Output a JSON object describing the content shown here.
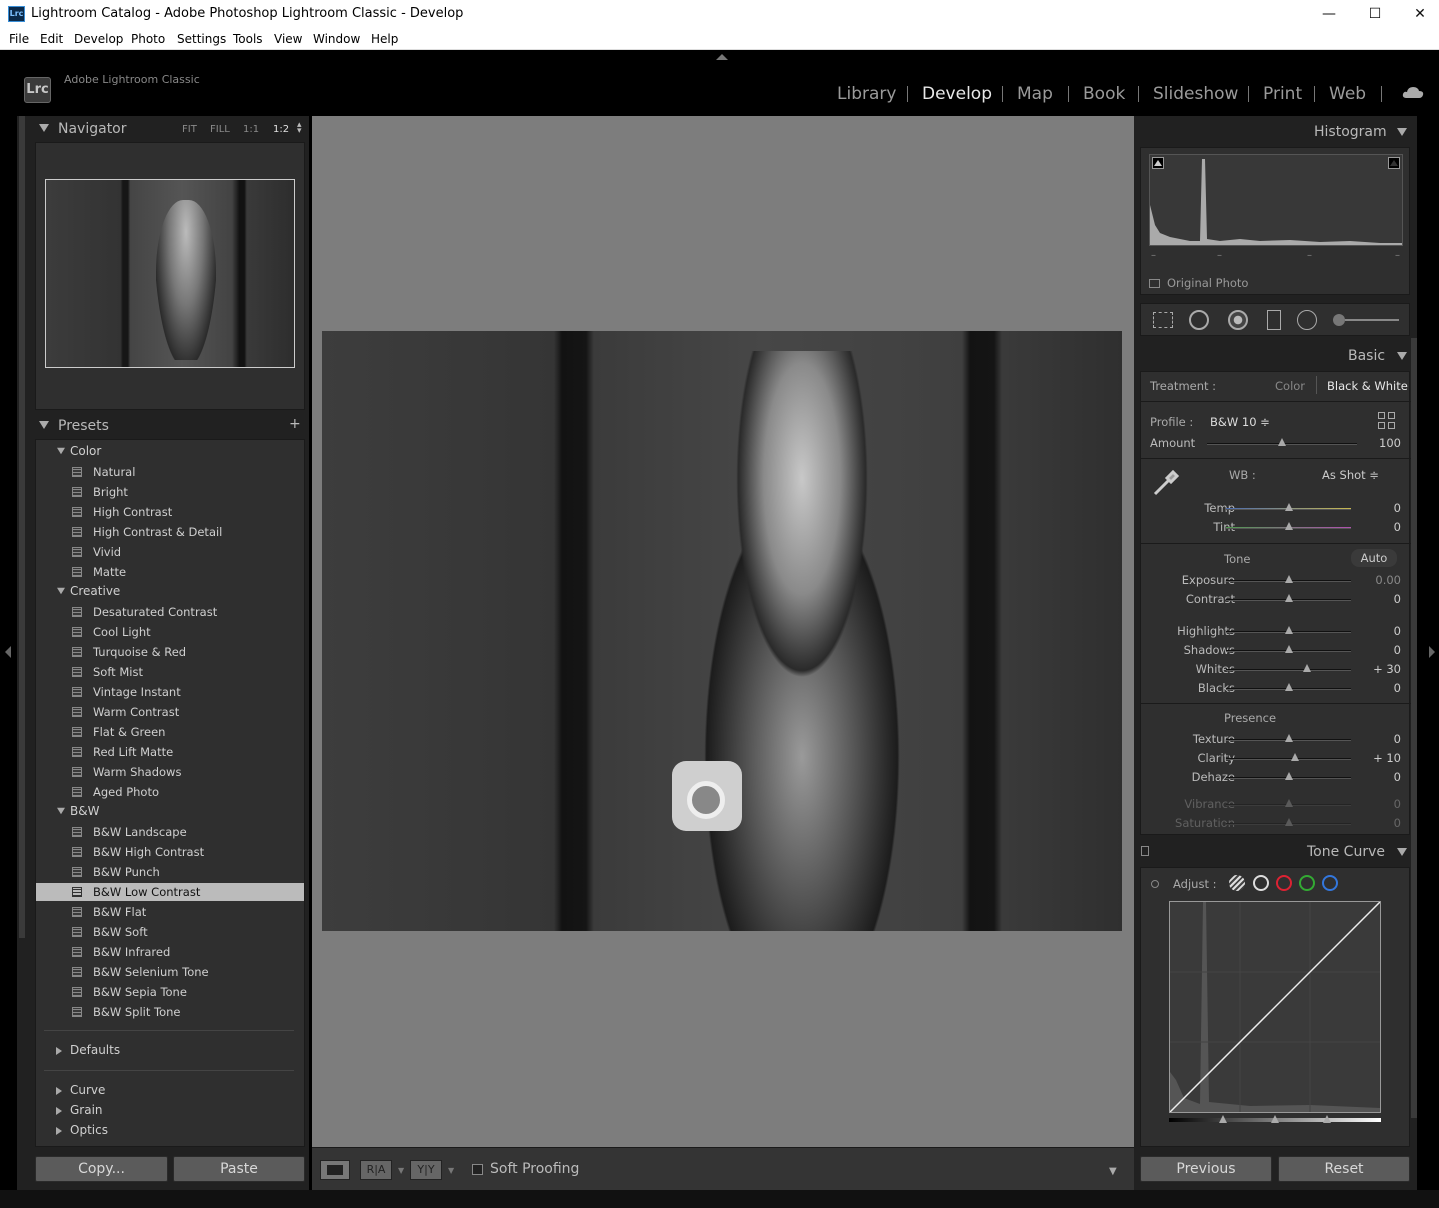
{
  "window": {
    "title": "Lightroom Catalog - Adobe Photoshop Lightroom Classic - Develop",
    "app_icon_text": "Lrc",
    "minimize": "—",
    "maximize": "☐",
    "close": "✕"
  },
  "menu": [
    "File",
    "Edit",
    "Develop",
    "Photo",
    "Settings",
    "Tools",
    "View",
    "Window",
    "Help"
  ],
  "identity": {
    "logo": "Lrc",
    "brand": "Adobe Lightroom Classic"
  },
  "modules": [
    {
      "label": "Library",
      "active": false
    },
    {
      "label": "Develop",
      "active": true
    },
    {
      "label": "Map",
      "active": false
    },
    {
      "label": "Book",
      "active": false
    },
    {
      "label": "Slideshow",
      "active": false
    },
    {
      "label": "Print",
      "active": false
    },
    {
      "label": "Web",
      "active": false
    }
  ],
  "navigator": {
    "title": "Navigator",
    "zoom_options": [
      "FIT",
      "FILL",
      "1:1",
      "1:2"
    ],
    "selected_zoom": "1:2"
  },
  "presets": {
    "title": "Presets",
    "add_label": "+",
    "groups": [
      {
        "name": "Color",
        "items": [
          "Natural",
          "Bright",
          "High Contrast",
          "High Contrast & Detail",
          "Vivid",
          "Matte"
        ]
      },
      {
        "name": "Creative",
        "items": [
          "Desaturated Contrast",
          "Cool Light",
          "Turquoise & Red",
          "Soft Mist",
          "Vintage Instant",
          "Warm Contrast",
          "Flat & Green",
          "Red Lift Matte",
          "Warm Shadows",
          "Aged Photo"
        ]
      },
      {
        "name": "B&W",
        "items": [
          "B&W Landscape",
          "B&W High Contrast",
          "B&W Punch",
          "B&W Low Contrast",
          "B&W Flat",
          "B&W Soft",
          "B&W Infrared",
          "B&W Selenium Tone",
          "B&W Sepia Tone",
          "B&W Split Tone"
        ]
      }
    ],
    "selected": "B&W Low Contrast",
    "collapsed_groups": [
      "Defaults",
      "Curve",
      "Grain",
      "Optics"
    ]
  },
  "left_buttons": {
    "copy": "Copy...",
    "paste": "Paste"
  },
  "toolbar": {
    "soft_proofing": "Soft Proofing",
    "view_ra": "R|A",
    "view_yy": "Y|Y"
  },
  "histogram": {
    "title": "Histogram",
    "original_photo": "Original Photo",
    "readouts": [
      "–",
      "–",
      "–",
      "–"
    ]
  },
  "basic": {
    "title": "Basic",
    "treatment_label": "Treatment :",
    "treatment_options": [
      "Color",
      "Black & White"
    ],
    "treatment_selected": "Black & White",
    "profile_label": "Profile :",
    "profile_value": "B&W 10 ≑",
    "amount_label": "Amount",
    "amount_value": "100",
    "wb_label": "WB :",
    "wb_value": "As Shot ≑",
    "temp": {
      "label": "Temp",
      "value": "0"
    },
    "tint": {
      "label": "Tint",
      "value": "0"
    },
    "tone_label": "Tone",
    "auto_label": "Auto",
    "exposure": {
      "label": "Exposure",
      "value": "0.00"
    },
    "contrast": {
      "label": "Contrast",
      "value": "0"
    },
    "highlights": {
      "label": "Highlights",
      "value": "0"
    },
    "shadows": {
      "label": "Shadows",
      "value": "0"
    },
    "whites": {
      "label": "Whites",
      "value": "+ 30"
    },
    "blacks": {
      "label": "Blacks",
      "value": "0"
    },
    "presence_label": "Presence",
    "texture": {
      "label": "Texture",
      "value": "0"
    },
    "clarity": {
      "label": "Clarity",
      "value": "+ 10"
    },
    "dehaze": {
      "label": "Dehaze",
      "value": "0"
    },
    "vibrance": {
      "label": "Vibrance",
      "value": "0"
    },
    "saturation": {
      "label": "Saturation",
      "value": "0"
    }
  },
  "slider_levels": {
    "amount": 0.5,
    "temp": 0.5,
    "tint": 0.5,
    "exposure": 0.5,
    "contrast": 0.5,
    "highlights": 0.5,
    "shadows": 0.5,
    "whites": 0.65,
    "blacks": 0.5,
    "texture": 0.5,
    "clarity": 0.55,
    "dehaze": 0.5,
    "vibrance": 0.5,
    "saturation": 0.5
  },
  "tone_curve": {
    "title": "Tone Curve",
    "adjust_label": "Adjust :"
  },
  "right_buttons": {
    "previous": "Previous",
    "reset": "Reset"
  },
  "colors": {
    "panel": "#2f2f2f",
    "bg": "#212121",
    "accent": "#e8e8e8",
    "canvas": "#7d7d7d"
  }
}
